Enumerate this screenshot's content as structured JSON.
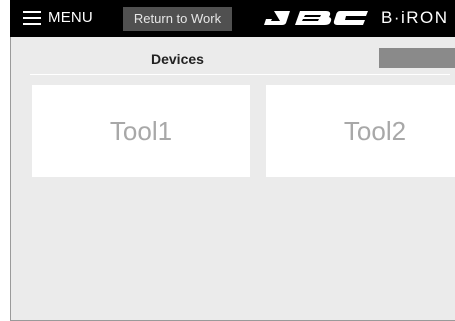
{
  "header": {
    "menu_label": "MENU",
    "return_label": "Return to Work",
    "brand_logo": "JBC",
    "product_logo": "B·iRON"
  },
  "main": {
    "title": "Devices",
    "devices": [
      {
        "label": "Tool1"
      },
      {
        "label": "Tool2"
      }
    ]
  },
  "colors": {
    "topbar": "#000000",
    "button": "#505050",
    "content_bg": "#ebebeb",
    "card_bg": "#ffffff",
    "card_text": "#a8a8a8"
  }
}
